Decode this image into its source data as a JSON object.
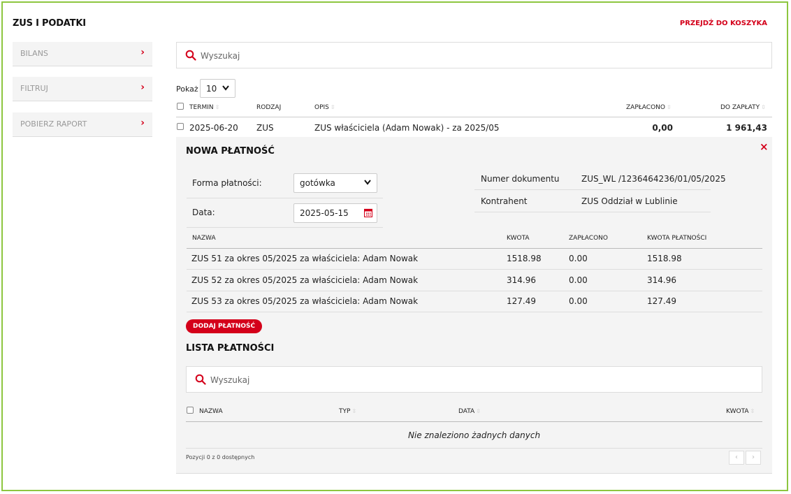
{
  "page": {
    "title": "ZUS I PODATKI",
    "cart_link": "PRZEJDŹ DO KOSZYKA"
  },
  "sidebar": {
    "items": [
      {
        "label": "BILANS"
      },
      {
        "label": "FILTRUJ"
      },
      {
        "label": "POBIERZ RAPORT"
      }
    ]
  },
  "search": {
    "placeholder": "Wyszukaj"
  },
  "show": {
    "label": "Pokaż",
    "value": "10"
  },
  "table": {
    "headers": {
      "termin": "TERMIN",
      "rodzaj": "RODZAJ",
      "opis": "OPIS",
      "zaplacono": "ZAPŁACONO",
      "do_zaplaty": "DO ZAPŁATY"
    },
    "row": {
      "termin": "2025-06-20",
      "rodzaj": "ZUS",
      "opis": "ZUS właściciela (Adam Nowak) - za 2025/05",
      "zaplacono": "0,00",
      "do_zaplaty": "1 961,43"
    }
  },
  "new_payment": {
    "title": "NOWA PŁATNOŚĆ",
    "close": "×",
    "form_label": "Forma płatności:",
    "form_value": "gotówka",
    "date_label": "Data:",
    "date_value": "2025-05-15",
    "doc_label": "Numer dokumentu",
    "doc_value": "ZUS_WL /1236464236/01/05/2025",
    "contractor_label": "Kontrahent",
    "contractor_value": "ZUS Oddział w Lublinie",
    "headers": {
      "nazwa": "NAZWA",
      "kwota": "KWOTA",
      "zaplacono": "ZAPŁACONO",
      "kwota_platnosci": "KWOTA PŁATNOŚCI"
    },
    "rows": [
      {
        "nazwa": "ZUS 51 za okres 05/2025 za właściciela: Adam Nowak",
        "kwota": "1518.98",
        "zaplacono": "0.00",
        "kwota_platnosci": "1518.98"
      },
      {
        "nazwa": "ZUS 52 za okres 05/2025 za właściciela: Adam Nowak",
        "kwota": "314.96",
        "zaplacono": "0.00",
        "kwota_platnosci": "314.96"
      },
      {
        "nazwa": "ZUS 53 za okres 05/2025 za właściciela: Adam Nowak",
        "kwota": "127.49",
        "zaplacono": "0.00",
        "kwota_platnosci": "127.49"
      }
    ],
    "add_button": "DODAJ PŁATNOŚĆ"
  },
  "payments_list": {
    "title": "LISTA PŁATNOŚCI",
    "search_placeholder": "Wyszukaj",
    "headers": {
      "nazwa": "NAZWA",
      "typ": "TYP",
      "data": "DATA",
      "kwota": "KWOTA"
    },
    "empty": "Nie znaleziono żadnych danych",
    "info": "Pozycji 0 z 0 dostępnych",
    "prev": "‹",
    "next": "›"
  },
  "colors": {
    "accent": "#d4001a",
    "frame": "#8dc63f",
    "panel": "#f4f4f4"
  }
}
